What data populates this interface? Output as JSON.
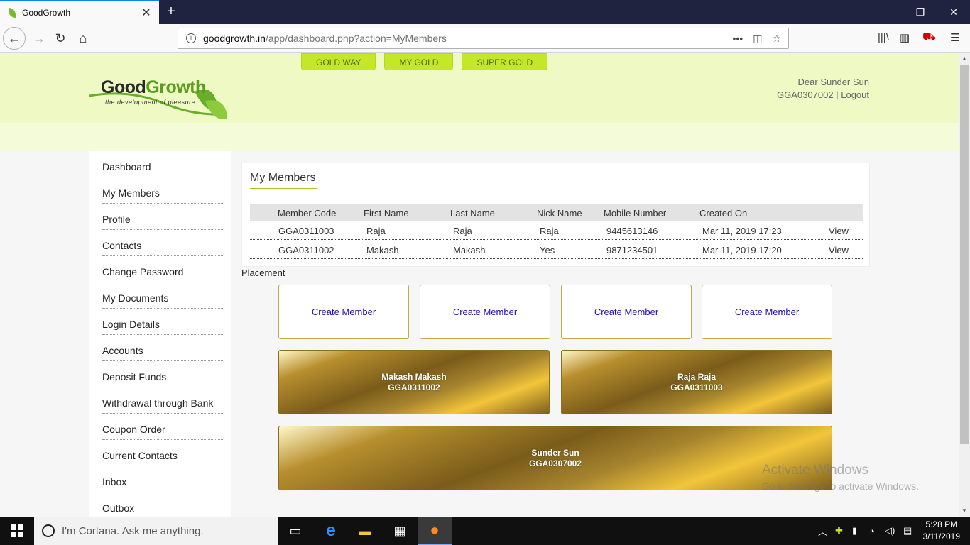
{
  "browser": {
    "tab_title": "GoodGrowth",
    "url_host": "goodgrowth.in",
    "url_path": "/app/dashboard.php?action=MyMembers",
    "icons": [
      "back-icon",
      "forward-icon",
      "reload-icon",
      "home-icon",
      "library-icon",
      "sidebar-icon",
      "menu-icon"
    ]
  },
  "header": {
    "logo_good": "Good",
    "logo_growth": "Growth",
    "logo_tagline": "the development of pleasure",
    "nav": [
      "GOLD WAY",
      "MY GOLD",
      "SUPER GOLD"
    ],
    "greeting": "Dear Sunder Sun",
    "user_code": "GGA0307002",
    "separator": "|",
    "logout": "Logout"
  },
  "sidebar": {
    "items": [
      {
        "label": "Dashboard"
      },
      {
        "label": "My Members"
      },
      {
        "label": "Profile"
      },
      {
        "label": "Contacts"
      },
      {
        "label": "Change Password"
      },
      {
        "label": "My Documents"
      },
      {
        "label": "Login Details"
      },
      {
        "label": "Accounts"
      },
      {
        "label": "Deposit Funds"
      },
      {
        "label": "Withdrawal through Bank"
      },
      {
        "label": "Coupon Order"
      },
      {
        "label": "Current Contacts"
      },
      {
        "label": "Inbox"
      },
      {
        "label": "Outbox"
      }
    ]
  },
  "members": {
    "title": "My Members",
    "columns": [
      "Member Code",
      "First Name",
      "Last Name",
      "Nick Name",
      "Mobile Number",
      "Created On"
    ],
    "rows": [
      {
        "code": "GGA0311003",
        "first": "Raja",
        "last": "Raja",
        "nick": "Raja",
        "mobile": "9445613146",
        "created": "Mar 11, 2019 17:23",
        "action": "View"
      },
      {
        "code": "GGA0311002",
        "first": "Makash",
        "last": "Makash",
        "nick": "Yes",
        "mobile": "9871234501",
        "created": "Mar 11, 2019 17:20",
        "action": "View"
      }
    ]
  },
  "placement": {
    "label": "Placement",
    "create_labels": [
      "Create Member",
      "Create Member",
      "Create Member",
      "Create Member"
    ],
    "level2": [
      {
        "name": "Makash Makash",
        "code": "GGA0311002"
      },
      {
        "name": "Raja Raja",
        "code": "GGA0311003"
      }
    ],
    "root": {
      "name": "Sunder Sun",
      "code": "GGA0307002"
    }
  },
  "watermark": {
    "line1": "Activate Windows",
    "line2": "Go to Settings to activate Windows."
  },
  "taskbar": {
    "search_placeholder": "I'm Cortana. Ask me anything.",
    "time": "5:28 PM",
    "date": "3/11/2019"
  }
}
